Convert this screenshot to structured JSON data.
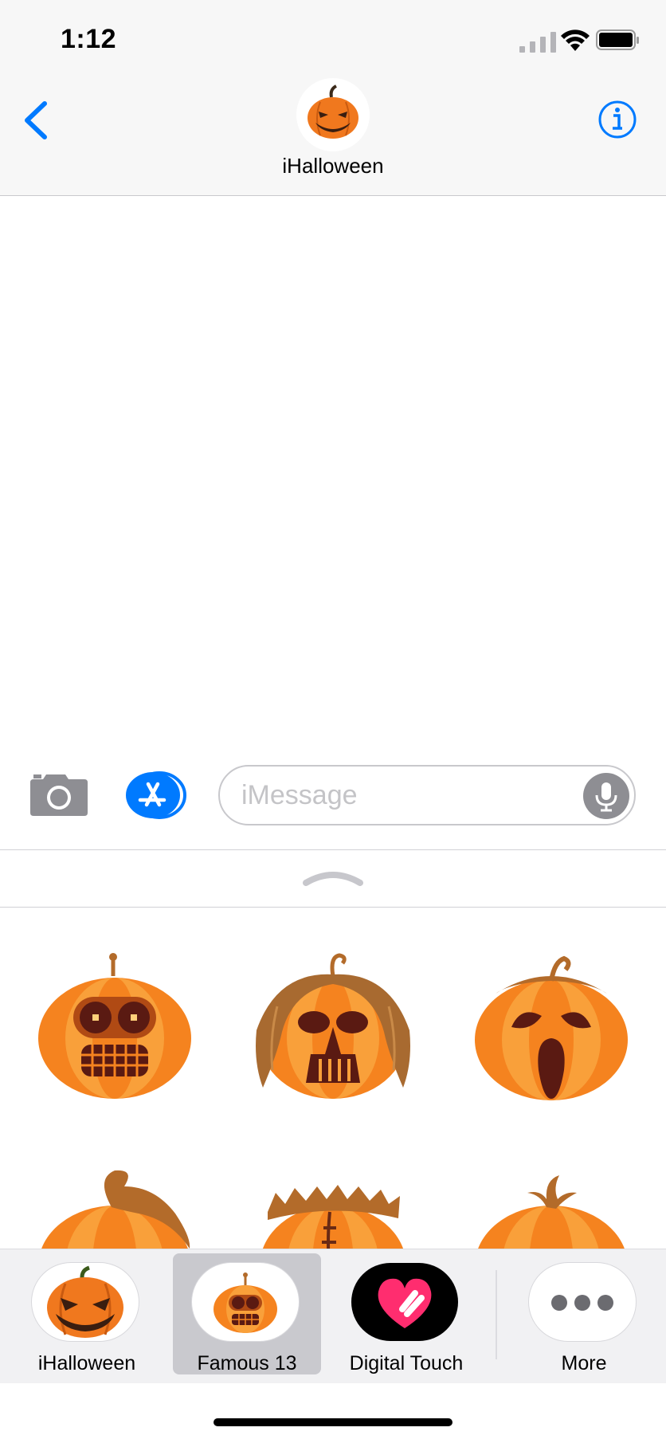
{
  "status_bar": {
    "time": "1:12"
  },
  "header": {
    "contact_name": "iHalloween"
  },
  "compose": {
    "placeholder": "iMessage"
  },
  "app_strip": {
    "apps": [
      {
        "label": "iHalloween"
      },
      {
        "label": "Famous 13",
        "selected": true
      },
      {
        "label": "Digital Touch"
      },
      {
        "label": "More"
      }
    ]
  },
  "colors": {
    "accent": "#007aff",
    "pumpkin": "#f27a1a",
    "pumpkin_light": "#f9a23a",
    "pumpkin_dark": "#5a1a12"
  },
  "stickers": [
    {
      "name": "robot-pumpkin"
    },
    {
      "name": "vader-pumpkin"
    },
    {
      "name": "scream-pumpkin"
    },
    {
      "name": "hair-pumpkin"
    },
    {
      "name": "frankenstein-pumpkin"
    },
    {
      "name": "angry-pumpkin"
    }
  ]
}
